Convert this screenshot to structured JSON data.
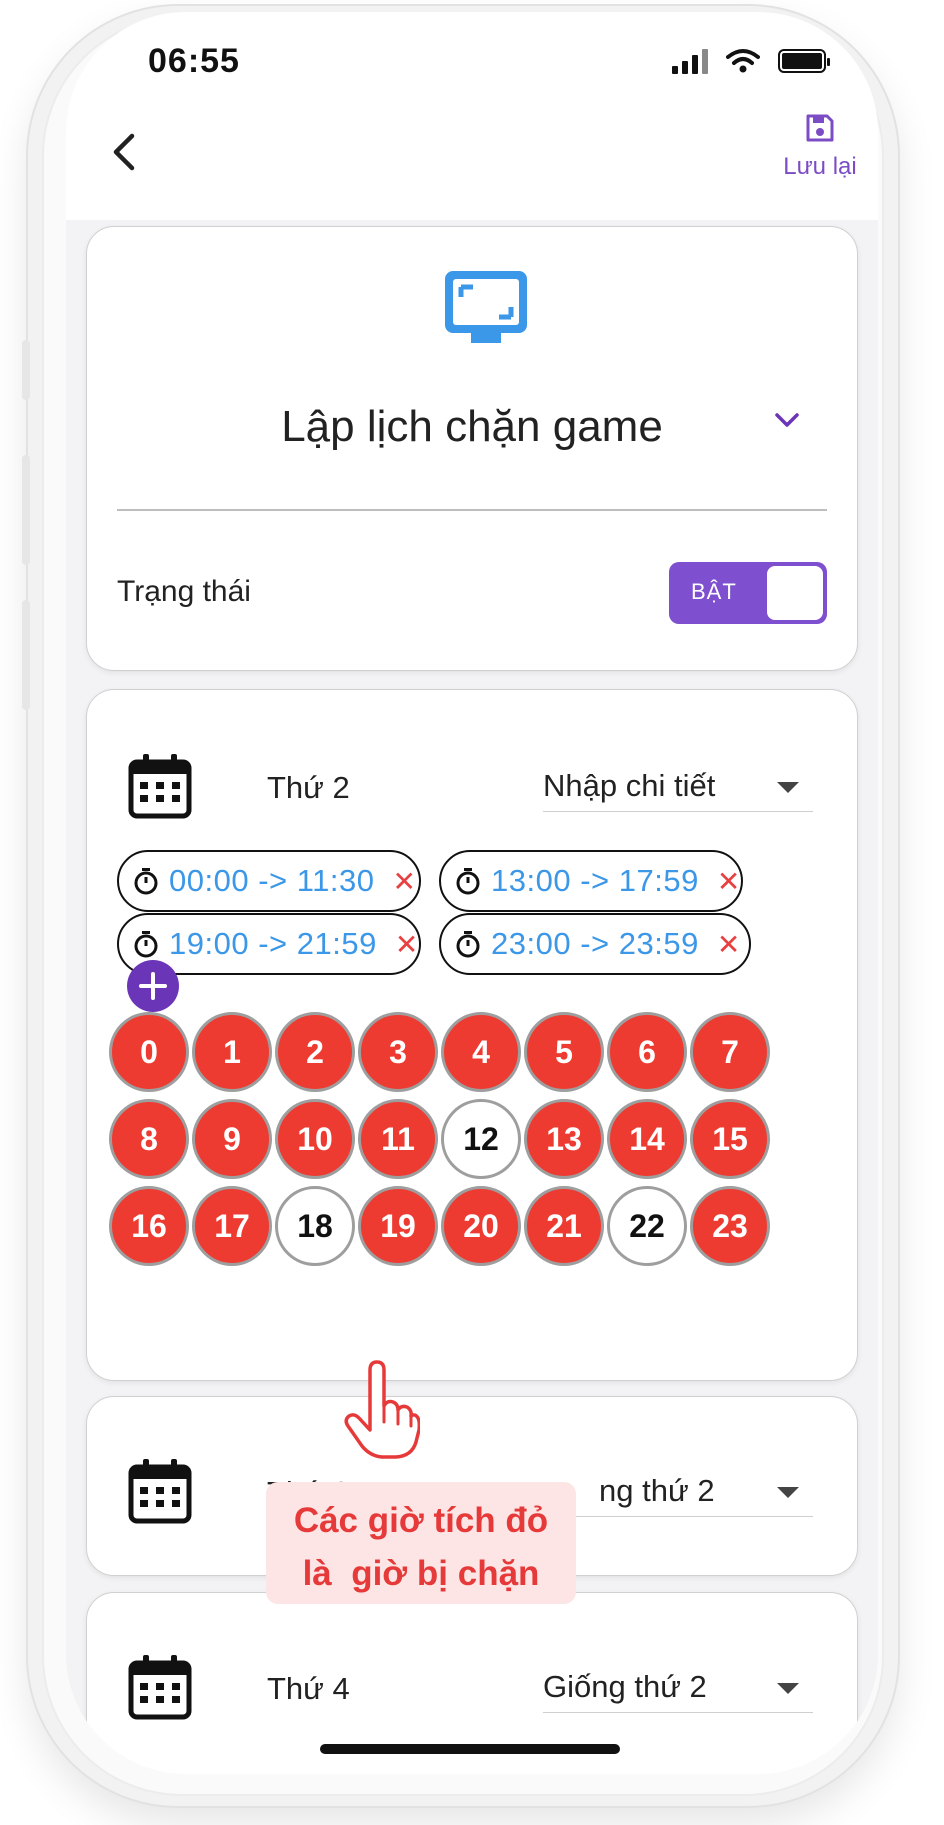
{
  "status_bar": {
    "time": "06:55"
  },
  "header": {
    "save_label": "Lưu lại"
  },
  "settings": {
    "title": "Lập lịch chặn game",
    "status_label": "Trạng thái",
    "toggle_label": "BẬT"
  },
  "days": [
    {
      "label": "Thứ 2",
      "mode": "Nhập chi tiết"
    },
    {
      "label": "Thứ 3",
      "mode": "ng thứ 2"
    },
    {
      "label": "Thứ 4",
      "mode": "Giống thứ 2"
    }
  ],
  "time_ranges": [
    "00:00 -> 11:30",
    "13:00 -> 17:59",
    "19:00 -> 21:59",
    "23:00 -> 23:59"
  ],
  "hours": [
    {
      "label": "0",
      "blocked": true
    },
    {
      "label": "1",
      "blocked": true
    },
    {
      "label": "2",
      "blocked": true
    },
    {
      "label": "3",
      "blocked": true
    },
    {
      "label": "4",
      "blocked": true
    },
    {
      "label": "5",
      "blocked": true
    },
    {
      "label": "6",
      "blocked": true
    },
    {
      "label": "7",
      "blocked": true
    },
    {
      "label": "8",
      "blocked": true
    },
    {
      "label": "9",
      "blocked": true
    },
    {
      "label": "10",
      "blocked": true
    },
    {
      "label": "11",
      "blocked": true
    },
    {
      "label": "12",
      "blocked": false
    },
    {
      "label": "13",
      "blocked": true
    },
    {
      "label": "14",
      "blocked": true
    },
    {
      "label": "15",
      "blocked": true
    },
    {
      "label": "16",
      "blocked": true
    },
    {
      "label": "17",
      "blocked": true
    },
    {
      "label": "18",
      "blocked": false
    },
    {
      "label": "19",
      "blocked": true
    },
    {
      "label": "20",
      "blocked": true
    },
    {
      "label": "21",
      "blocked": true
    },
    {
      "label": "22",
      "blocked": false
    },
    {
      "label": "23",
      "blocked": true
    }
  ],
  "annotation": {
    "line1": "Các giờ tích đỏ",
    "line2": "là  giờ bị chặn"
  },
  "colors": {
    "accent": "#7e4fcf",
    "blocked": "#ee3b32",
    "time_text": "#3b97e8",
    "tv_icon": "#3b97e8"
  }
}
